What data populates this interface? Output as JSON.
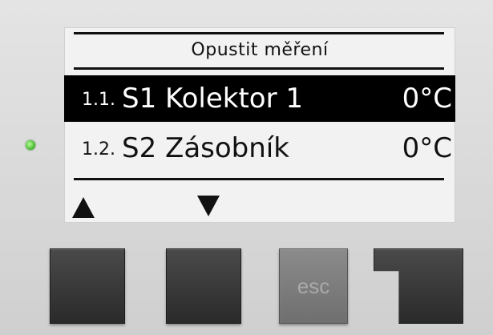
{
  "display": {
    "title": "Opustit měření",
    "rows": [
      {
        "index": "1.1.",
        "name": "S1 Kolektor 1",
        "value": "0°C",
        "selected": true
      },
      {
        "index": "1.2.",
        "name": "S2 Zásobník",
        "value": "0°C",
        "selected": false
      }
    ]
  },
  "buttons": {
    "esc_label": "esc"
  },
  "icons": {
    "up": "arrow-up-icon",
    "down": "arrow-down-icon",
    "led": "status-led"
  },
  "colors": {
    "screen_bg": "#f2f2f2",
    "selection_bg": "#000000",
    "led": "#3fb22a"
  }
}
